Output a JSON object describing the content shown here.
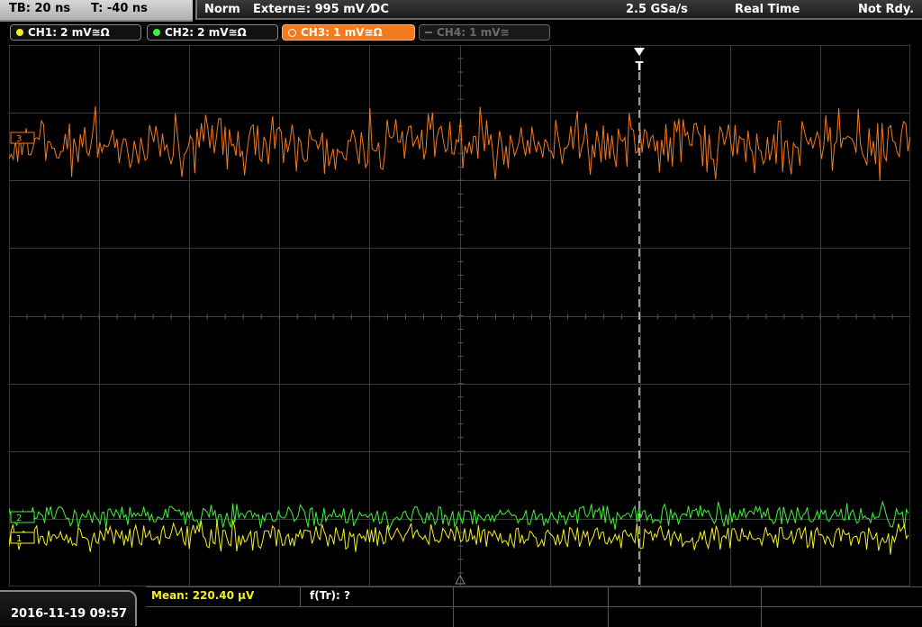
{
  "topbar": {
    "timebase": "TB: 20 ns",
    "trigger_time": "T: -40 ns",
    "trigger_mode": "Norm",
    "trigger_source": "Extern≅: 995 mV ⁄DC",
    "sample_rate": "2.5 GSa/s",
    "acq_mode": "Real Time",
    "status": "Not Rdy."
  },
  "channels": [
    {
      "label": "CH1: 2 mV≅Ω",
      "color": "#f4ef22",
      "state": "on"
    },
    {
      "label": "CH2: 2 mV≅Ω",
      "color": "#3ef23a",
      "state": "on"
    },
    {
      "label": "CH3: 1 mV≅Ω",
      "color": "#f47a1e",
      "state": "selected"
    },
    {
      "label": "CH4: 1 mV≅",
      "color": "#6a6a6a",
      "state": "off"
    }
  ],
  "markers": {
    "ch3": "3",
    "ch2": "2",
    "ch1": "1",
    "trigger": "T"
  },
  "bottom": {
    "datetime": "2016-11-19 09:57",
    "meas_mean": "Mean: 220.40 µV",
    "meas_freq": "f(Tr): ?"
  },
  "colors": {
    "ch1": "#f4ef22",
    "ch2": "#3ef23a",
    "ch3": "#f47a1e",
    "grid": "#3a3a3a",
    "trigger_line": "#ffffff"
  }
}
